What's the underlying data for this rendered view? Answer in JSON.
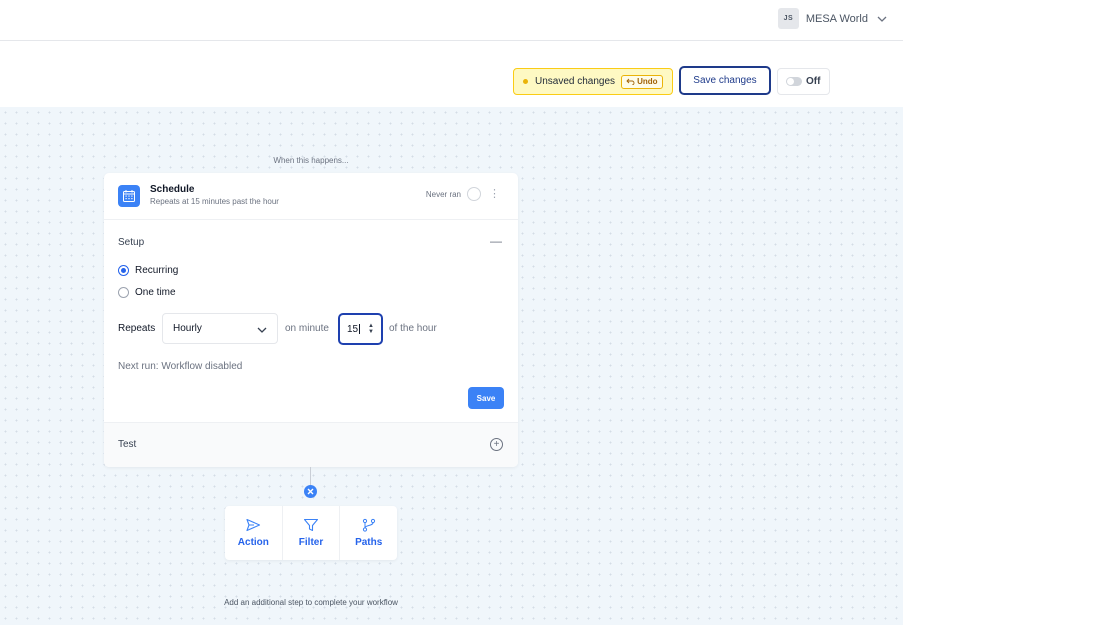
{
  "account": {
    "initials": "JS",
    "name": "MESA World"
  },
  "toolbar": {
    "unsaved_label": "Unsaved changes",
    "undo_label": "Undo",
    "save_changes_label": "Save changes",
    "toggle_label": "Off"
  },
  "canvas": {
    "trigger_heading": "When this happens...",
    "trigger": {
      "title": "Schedule",
      "subtitle": "Repeats at 15 minutes past the hour",
      "status": "Never ran"
    },
    "setup": {
      "label": "Setup",
      "options": [
        "Recurring",
        "One time"
      ],
      "selected_option": "Recurring",
      "repeats_label": "Repeats",
      "frequency": "Hourly",
      "on_minute_label": "on minute",
      "minute_value": "15",
      "of_hour_label": "of the hour",
      "next_run": "Next run: Workflow disabled",
      "save_label": "Save"
    },
    "test_label": "Test",
    "step_options": [
      {
        "label": "Action",
        "icon": "send-icon"
      },
      {
        "label": "Filter",
        "icon": "filter-icon"
      },
      {
        "label": "Paths",
        "icon": "branch-icon"
      }
    ],
    "hint": "Add an additional step to complete your workflow"
  },
  "colors": {
    "accent": "#3b82f6",
    "focus_border": "#1e40af",
    "unsaved_bg": "#fef9c3",
    "canvas_bg": "#f0f6fb"
  }
}
